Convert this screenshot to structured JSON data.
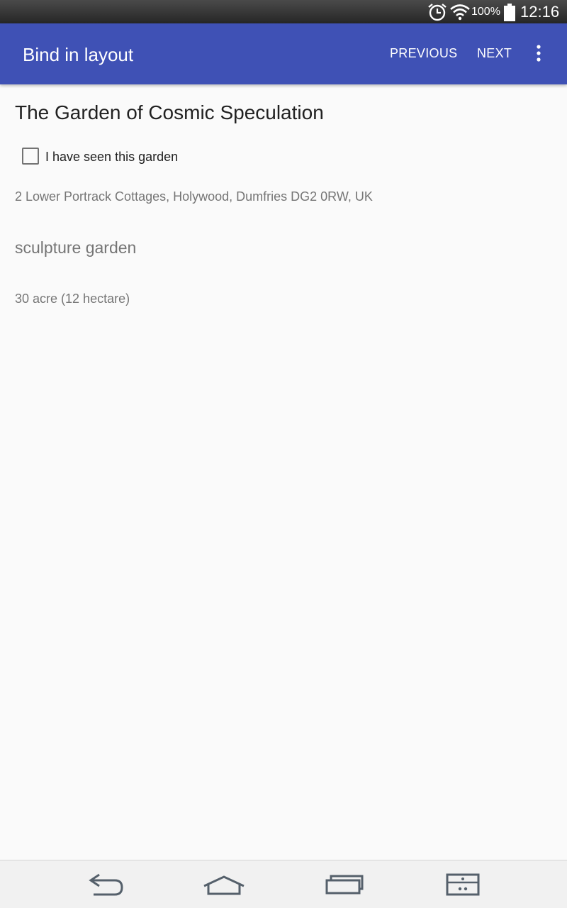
{
  "status_bar": {
    "battery_percent": "100%",
    "time": "12:16",
    "icons": [
      "alarm-icon",
      "wifi-icon",
      "battery-icon"
    ]
  },
  "app_bar": {
    "title": "Bind in layout",
    "previous_label": "PREVIOUS",
    "next_label": "NEXT",
    "overflow_icon": "more-vert-icon",
    "background_color": "#3f51b5"
  },
  "garden": {
    "name": "The Garden of Cosmic Speculation",
    "seen_checkbox_label": "I have seen this garden",
    "seen_checked": false,
    "address": "2 Lower Portrack Cottages, Holywood, Dumfries DG2 0RW, UK",
    "type": "sculpture garden",
    "size": "30 acre (12 hectare)"
  },
  "nav_bar": {
    "icons": [
      "back-icon",
      "home-icon",
      "recent-apps-icon",
      "menu-icon"
    ]
  }
}
